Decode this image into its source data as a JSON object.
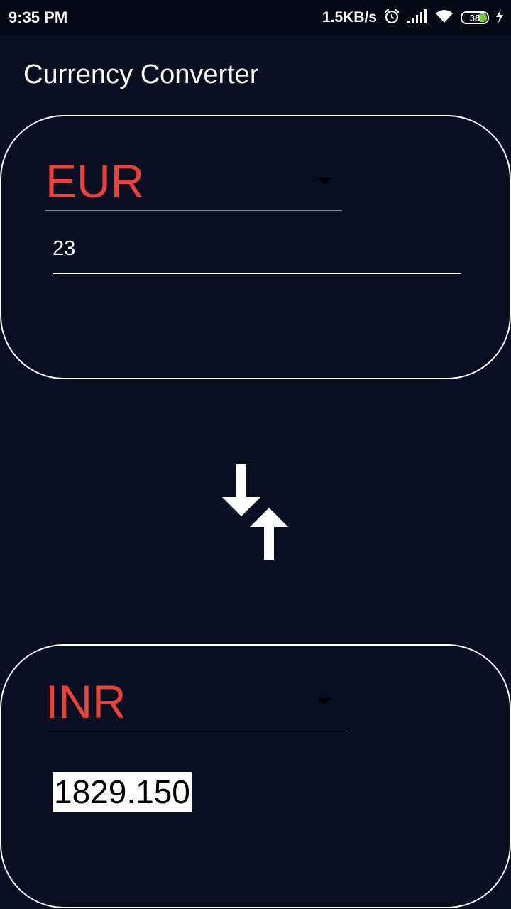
{
  "status_bar": {
    "time": "9:35 PM",
    "network_speed": "1.5KB/s",
    "battery_level": "38",
    "battery_fraction": 0.38,
    "icons": [
      "alarm-icon",
      "signal-icon",
      "wifi-icon",
      "battery-icon",
      "charging-icon"
    ]
  },
  "app": {
    "title": "Currency Converter"
  },
  "from": {
    "currency": "EUR",
    "amount": "23"
  },
  "to": {
    "currency": "INR",
    "result": "1829.150"
  },
  "swap": {
    "icon": "swap-vertical-icon"
  },
  "colors": {
    "background": "#0a0e21",
    "accent": "#e8423b",
    "outline": "#ffffff",
    "battery_fill": "#76c442"
  }
}
